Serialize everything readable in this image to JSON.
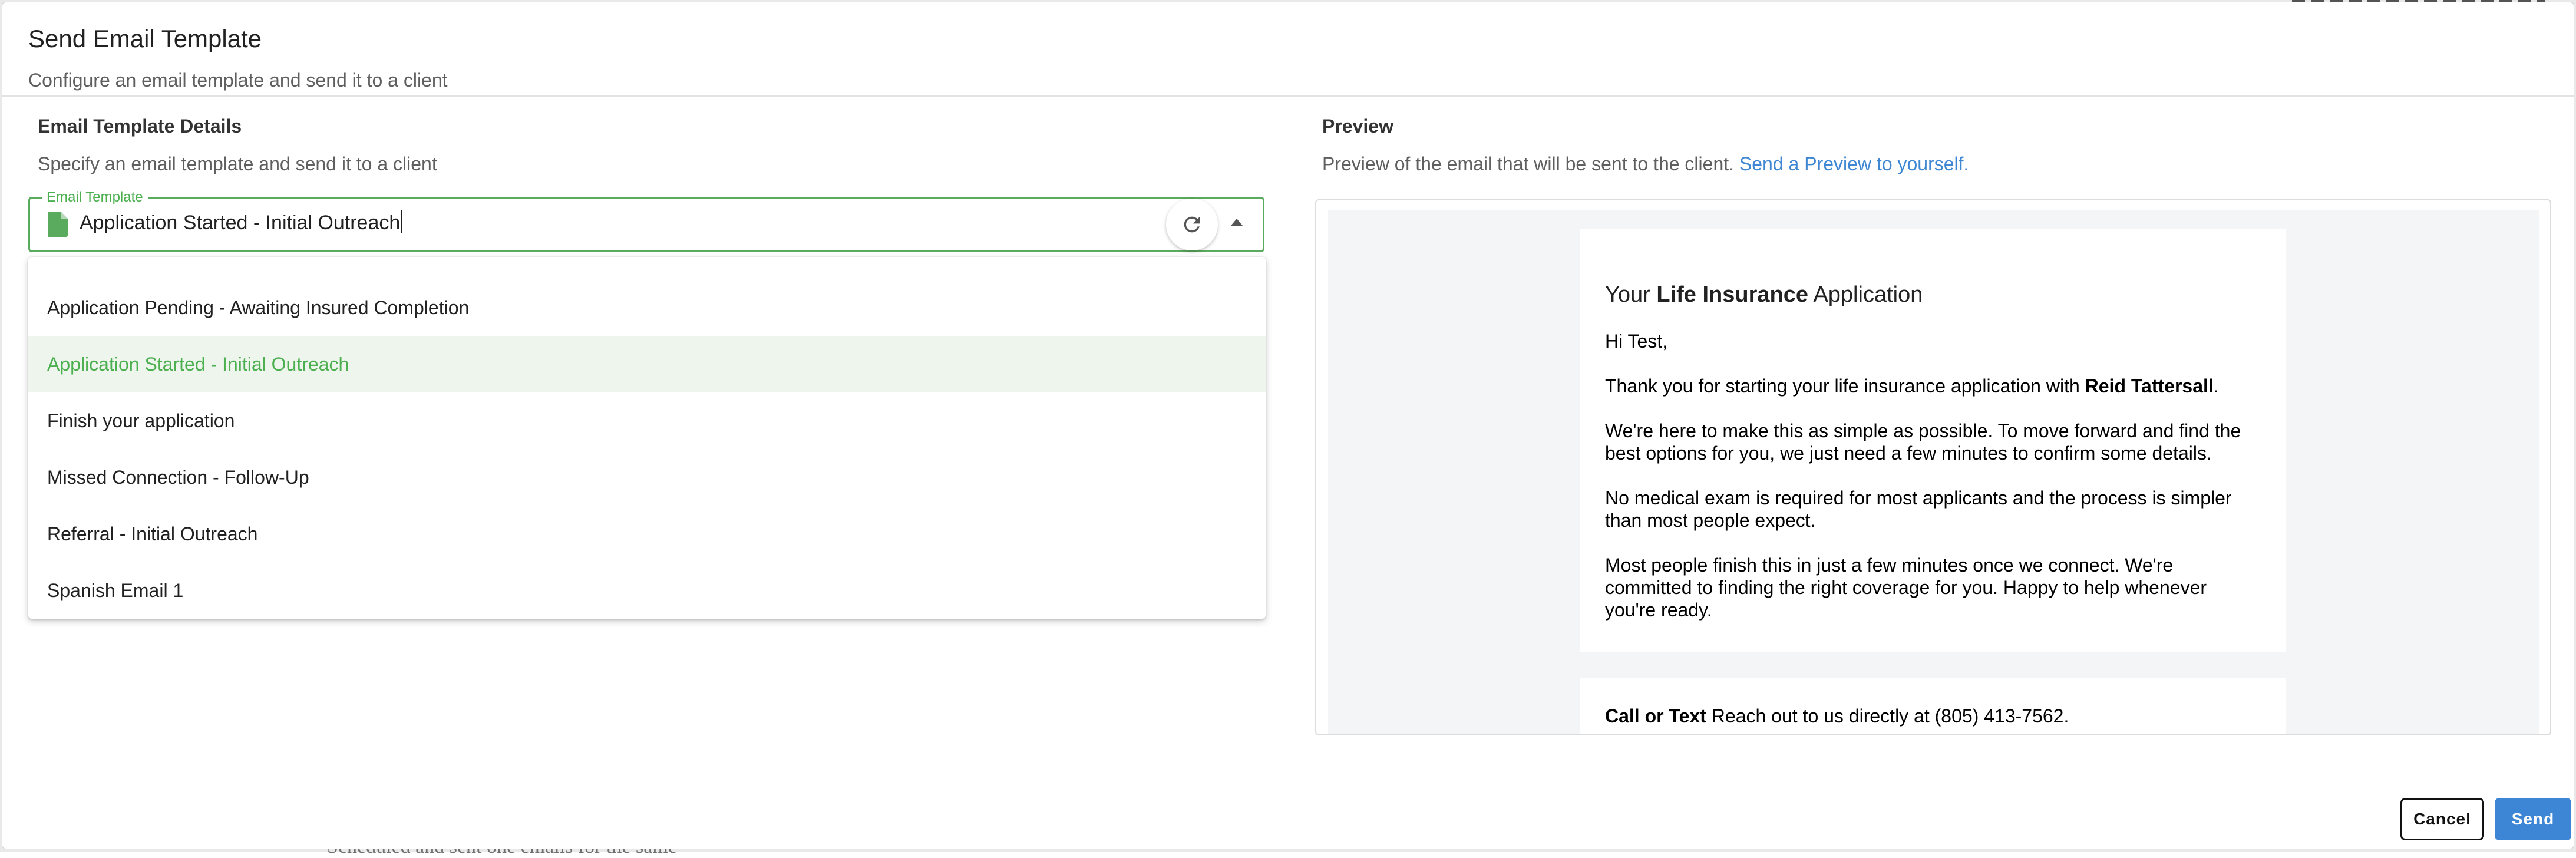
{
  "background": {
    "fragment_text": "Scheduled and sent one emails for the same"
  },
  "dialog": {
    "title": "Send Email Template",
    "subtitle": "Configure an email template and send it to a client"
  },
  "details": {
    "title": "Email Template Details",
    "subtitle": "Specify an email template and send it to a client",
    "field_label": "Email Template",
    "field_value": "Application Started - Initial Outreach",
    "options": [
      {
        "label": "Application Pending - Awaiting Insured Completion",
        "selected": false
      },
      {
        "label": "Application Started - Initial Outreach",
        "selected": true
      },
      {
        "label": "Finish your application",
        "selected": false
      },
      {
        "label": "Missed Connection - Follow-Up",
        "selected": false
      },
      {
        "label": "Referral - Initial Outreach",
        "selected": false
      },
      {
        "label": "Spanish Email 1",
        "selected": false
      }
    ]
  },
  "preview": {
    "title": "Preview",
    "subtitle": "Preview of the email that will be sent to the client.",
    "link": "Send a Preview to yourself.",
    "email": {
      "heading_pre": "Your ",
      "heading_bold": "Life Insurance",
      "heading_post": " Application",
      "greeting": "Hi Test,",
      "p1_pre": "Thank you for starting your life insurance application with ",
      "p1_bold": "Reid Tattersall",
      "p1_post": ".",
      "p2": "We're here to make this as simple as possible. To move forward and find the best options for you, we just need a few minutes to confirm some details.",
      "p3": "No medical exam is required for most applicants and the process is simpler than most people expect.",
      "p4": "Most people finish this in just a few minutes once we connect. We're committed to finding the right coverage for you. Happy to help whenever you're ready.",
      "contact_bold": "Call or Text",
      "contact_text": " Reach out to us directly at (805) 413-7562."
    }
  },
  "actions": {
    "cancel": "Cancel",
    "send": "Send"
  },
  "colors": {
    "accent_green": "#4caf50",
    "link_blue": "#3f87d3",
    "send_blue": "#3d86d6"
  }
}
